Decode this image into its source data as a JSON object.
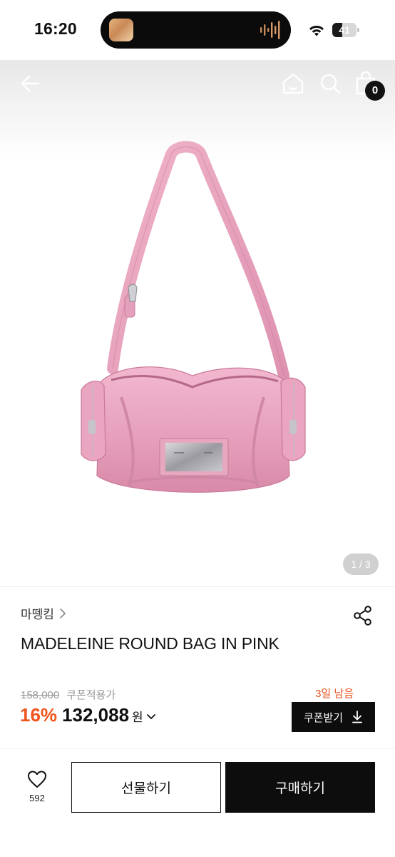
{
  "status_bar": {
    "time": "16:20",
    "battery_level": "41",
    "battery_fraction": 0.41
  },
  "header": {
    "cart_count": "0",
    "icons": [
      "back-arrow-icon",
      "home-icon",
      "search-icon",
      "shopping-bag-icon"
    ]
  },
  "gallery": {
    "page_indicator": "1 / 3"
  },
  "product": {
    "brand": "마뗑킴",
    "title": "MADELEINE ROUND BAG IN PINK",
    "original_price": "158,000",
    "coupon_note": "쿠폰적용가",
    "days_left": "3일 남음",
    "discount_rate": "16%",
    "sale_price": "132,088",
    "currency": "원",
    "coupon_button_label": "쿠폰받기"
  },
  "bottom_bar": {
    "like_count": "592",
    "gift_label": "선물하기",
    "buy_label": "구매하기"
  },
  "colors": {
    "accent_orange": "#f0531c",
    "black": "#0d0d0d",
    "bag_pink": "#e6a3bd"
  }
}
